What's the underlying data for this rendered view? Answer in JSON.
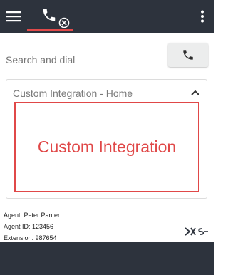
{
  "header": {
    "menu_icon": "hamburger-menu-icon",
    "phone_tab_icon": "phone-icon",
    "disconnected_badge_icon": "circle-x-icon",
    "overflow_icon": "kebab-menu-icon",
    "background_color": "#2d333d",
    "active_tab_color": "#e14a4a"
  },
  "search": {
    "placeholder": "Search and dial",
    "value": "",
    "dial_button_icon": "phone-icon"
  },
  "integration": {
    "title": "Custom Integration - Home",
    "collapse_icon": "chevron-up-icon",
    "content_text": "Custom Integration",
    "accent_color": "#e04848"
  },
  "agent": {
    "name_line": "Agent: Peter Panter",
    "id_line": "Agent ID: 123456",
    "extension_line": "Extension: 987654"
  },
  "brand": {
    "logo_icon": "brand-logo-icon"
  }
}
